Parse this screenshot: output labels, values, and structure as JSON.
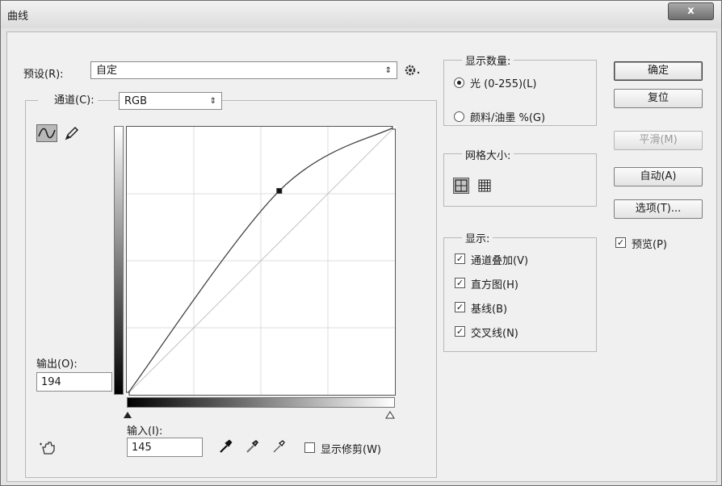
{
  "window": {
    "title": "曲线",
    "close": "x"
  },
  "preset": {
    "label": "预设(R):",
    "value": "自定",
    "menu_icon": "gear-icon"
  },
  "channel": {
    "label": "通道(C):",
    "value": "RGB"
  },
  "curve_tools": {
    "edit_points": "curve-point-tool-icon",
    "pencil": "pencil-icon"
  },
  "output": {
    "label": "输出(O):",
    "value": "194"
  },
  "input": {
    "label": "输入(I):",
    "value": "145"
  },
  "curve": {
    "range": [
      0,
      255
    ],
    "points": [
      [
        0,
        0
      ],
      [
        145,
        194
      ],
      [
        255,
        255
      ]
    ],
    "selected_point": [
      145,
      194
    ],
    "line_color": "#444444"
  },
  "show_clipping": {
    "label": "显示修剪(W)",
    "checked": false
  },
  "show_amount": {
    "legend": "显示数量:",
    "options": [
      {
        "label": "光 (0-255)(L)",
        "selected": true
      },
      {
        "label": "颜料/油墨 %(G)",
        "selected": false
      }
    ]
  },
  "grid_size": {
    "legend": "网格大小:"
  },
  "show": {
    "legend": "显示:",
    "options": [
      {
        "label": "通道叠加(V)",
        "checked": true
      },
      {
        "label": "直方图(H)",
        "checked": true
      },
      {
        "label": "基线(B)",
        "checked": true
      },
      {
        "label": "交叉线(N)",
        "checked": true
      }
    ]
  },
  "buttons": {
    "ok": "确定",
    "reset": "复位",
    "smooth": "平滑(M)",
    "auto": "自动(A)",
    "options": "选项(T)..."
  },
  "preview": {
    "label": "预览(P)",
    "checked": true
  }
}
